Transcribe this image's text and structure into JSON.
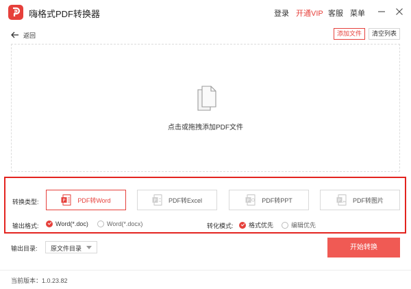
{
  "app": {
    "title": "嗨格式PDF转换器"
  },
  "header": {
    "login": "登录",
    "vip": "开通VIP",
    "service": "客服",
    "menu": "菜单"
  },
  "toolbar": {
    "back_label": "返回",
    "add_file_label": "添加文件",
    "clear_list_label": "清空列表"
  },
  "dropzone": {
    "text": "点击或拖拽添加PDF文件"
  },
  "conversion": {
    "type_label": "转换类型:",
    "options": [
      {
        "label": "PDF转Word",
        "icon": "word-icon",
        "selected": true
      },
      {
        "label": "PDF转Excel",
        "icon": "excel-icon",
        "selected": false
      },
      {
        "label": "PDF转PPT",
        "icon": "ppt-icon",
        "selected": false
      },
      {
        "label": "PDF转图片",
        "icon": "image-icon",
        "selected": false
      }
    ],
    "format_label": "输出格式:",
    "formats": [
      {
        "label": "Word(*.doc)",
        "checked": true
      },
      {
        "label": "Word(*.docx)",
        "checked": false
      }
    ],
    "mode_label": "转化模式:",
    "modes": [
      {
        "label": "格式优先",
        "checked": true
      },
      {
        "label": "编辑优先",
        "checked": false
      }
    ]
  },
  "output": {
    "dir_label": "输出目录:",
    "dir_value": "原文件目录"
  },
  "actions": {
    "start_label": "开始转换"
  },
  "footer": {
    "version": "当前版本：1.0.23.82"
  },
  "colors": {
    "accent": "#e6403b",
    "start_button": "#f05a54",
    "highlight_border": "#e3231e"
  }
}
